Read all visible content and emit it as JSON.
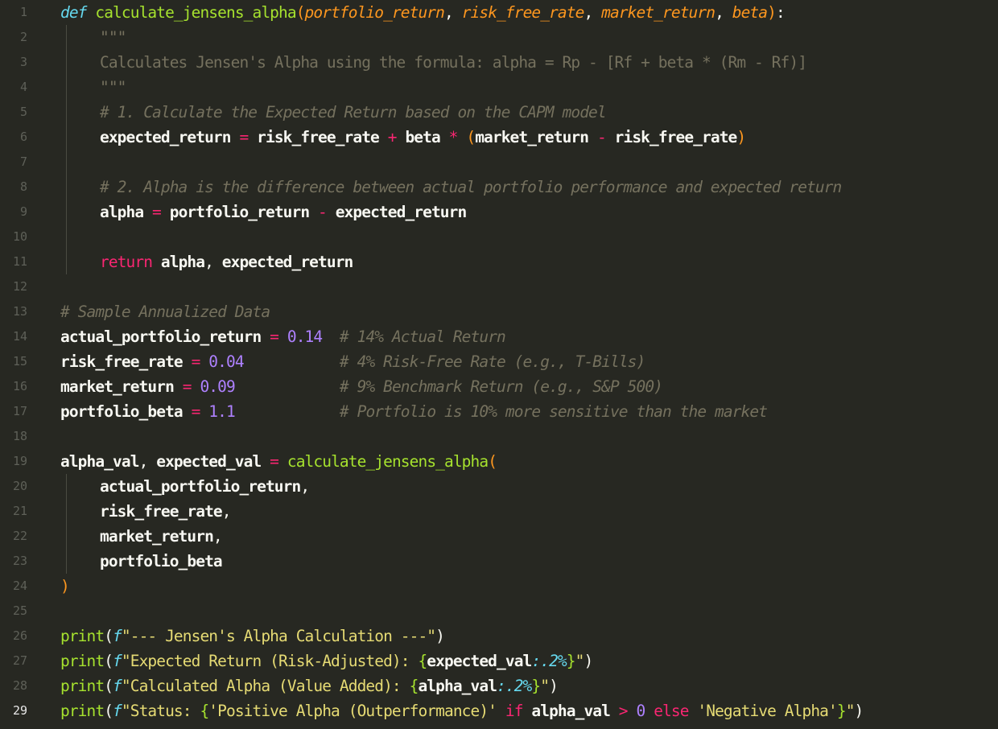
{
  "editor": {
    "language": "python",
    "current_line": 29,
    "lines": [
      {
        "n": "1",
        "indent": 0,
        "tokens": [
          [
            "kw",
            "def"
          ],
          [
            "pc",
            " "
          ],
          [
            "fn",
            "calculate_jensens_alpha"
          ],
          [
            "pn",
            "("
          ],
          [
            "par",
            "portfolio_return"
          ],
          [
            "pc",
            ", "
          ],
          [
            "par",
            "risk_free_rate"
          ],
          [
            "pc",
            ", "
          ],
          [
            "par",
            "market_return"
          ],
          [
            "pc",
            ", "
          ],
          [
            "par",
            "beta"
          ],
          [
            "pn",
            ")"
          ],
          [
            "pc",
            ":"
          ]
        ]
      },
      {
        "n": "2",
        "indent": 1,
        "tokens": [
          [
            "doc",
            "\"\"\""
          ]
        ]
      },
      {
        "n": "3",
        "indent": 1,
        "tokens": [
          [
            "doc",
            "Calculates Jensen's Alpha using the formula: alpha = Rp - [Rf + beta * (Rm - Rf)]"
          ]
        ]
      },
      {
        "n": "4",
        "indent": 1,
        "tokens": [
          [
            "doc",
            "\"\"\""
          ]
        ]
      },
      {
        "n": "5",
        "indent": 1,
        "tokens": [
          [
            "cm",
            "# 1. Calculate the Expected Return based on the CAPM model"
          ]
        ]
      },
      {
        "n": "6",
        "indent": 1,
        "tokens": [
          [
            "id",
            "expected_return"
          ],
          [
            "op",
            " = "
          ],
          [
            "id",
            "risk_free_rate"
          ],
          [
            "op",
            " + "
          ],
          [
            "id",
            "beta"
          ],
          [
            "op",
            " * "
          ],
          [
            "pn",
            "("
          ],
          [
            "id",
            "market_return"
          ],
          [
            "op",
            " - "
          ],
          [
            "id",
            "risk_free_rate"
          ],
          [
            "pn",
            ")"
          ]
        ]
      },
      {
        "n": "7",
        "indent": 0,
        "tokens": []
      },
      {
        "n": "8",
        "indent": 1,
        "tokens": [
          [
            "cm",
            "# 2. Alpha is the difference between actual portfolio performance and expected return"
          ]
        ]
      },
      {
        "n": "9",
        "indent": 1,
        "tokens": [
          [
            "id",
            "alpha"
          ],
          [
            "op",
            " = "
          ],
          [
            "id",
            "portfolio_return"
          ],
          [
            "op",
            " - "
          ],
          [
            "id",
            "expected_return"
          ]
        ]
      },
      {
        "n": "10",
        "indent": 0,
        "tokens": []
      },
      {
        "n": "11",
        "indent": 1,
        "tokens": [
          [
            "kr",
            "return"
          ],
          [
            "pc",
            " "
          ],
          [
            "id",
            "alpha"
          ],
          [
            "pc",
            ", "
          ],
          [
            "id",
            "expected_return"
          ]
        ]
      },
      {
        "n": "12",
        "indent": 0,
        "tokens": []
      },
      {
        "n": "13",
        "indent": 0,
        "tokens": [
          [
            "cm",
            "# Sample Annualized Data"
          ]
        ]
      },
      {
        "n": "14",
        "indent": 0,
        "tokens": [
          [
            "id",
            "actual_portfolio_return"
          ],
          [
            "op",
            " = "
          ],
          [
            "num",
            "0.14"
          ],
          [
            "pc",
            "  "
          ],
          [
            "cm",
            "# 14% Actual Return"
          ]
        ]
      },
      {
        "n": "15",
        "indent": 0,
        "tokens": [
          [
            "id",
            "risk_free_rate"
          ],
          [
            "op",
            " = "
          ],
          [
            "num",
            "0.04"
          ],
          [
            "pc",
            "           "
          ],
          [
            "cm",
            "# 4% Risk-Free Rate (e.g., T-Bills)"
          ]
        ]
      },
      {
        "n": "16",
        "indent": 0,
        "tokens": [
          [
            "id",
            "market_return"
          ],
          [
            "op",
            " = "
          ],
          [
            "num",
            "0.09"
          ],
          [
            "pc",
            "            "
          ],
          [
            "cm",
            "# 9% Benchmark Return (e.g., S&P 500)"
          ]
        ]
      },
      {
        "n": "17",
        "indent": 0,
        "tokens": [
          [
            "id",
            "portfolio_beta"
          ],
          [
            "op",
            " = "
          ],
          [
            "num",
            "1.1"
          ],
          [
            "pc",
            "            "
          ],
          [
            "cm",
            "# Portfolio is 10% more sensitive than the market"
          ]
        ]
      },
      {
        "n": "18",
        "indent": 0,
        "tokens": []
      },
      {
        "n": "19",
        "indent": 0,
        "tokens": [
          [
            "id",
            "alpha_val"
          ],
          [
            "pc",
            ", "
          ],
          [
            "id",
            "expected_val"
          ],
          [
            "op",
            " = "
          ],
          [
            "fn",
            "calculate_jensens_alpha"
          ],
          [
            "pn",
            "("
          ]
        ]
      },
      {
        "n": "20",
        "indent": 1,
        "tokens": [
          [
            "id",
            "actual_portfolio_return"
          ],
          [
            "pc",
            ","
          ]
        ]
      },
      {
        "n": "21",
        "indent": 1,
        "tokens": [
          [
            "id",
            "risk_free_rate"
          ],
          [
            "pc",
            ","
          ]
        ]
      },
      {
        "n": "22",
        "indent": 1,
        "tokens": [
          [
            "id",
            "market_return"
          ],
          [
            "pc",
            ","
          ]
        ]
      },
      {
        "n": "23",
        "indent": 1,
        "tokens": [
          [
            "id",
            "portfolio_beta"
          ]
        ]
      },
      {
        "n": "24",
        "indent": 0,
        "tokens": [
          [
            "pn",
            ")"
          ]
        ]
      },
      {
        "n": "25",
        "indent": 0,
        "tokens": []
      },
      {
        "n": "26",
        "indent": 0,
        "tokens": [
          [
            "fn",
            "print"
          ],
          [
            "pc",
            "("
          ],
          [
            "fx",
            "f"
          ],
          [
            "str",
            "\"--- Jensen's Alpha Calculation ---\""
          ],
          [
            "pc",
            ")"
          ]
        ]
      },
      {
        "n": "27",
        "indent": 0,
        "tokens": [
          [
            "fn",
            "print"
          ],
          [
            "pc",
            "("
          ],
          [
            "fx",
            "f"
          ],
          [
            "str",
            "\"Expected Return (Risk-Adjusted): "
          ],
          [
            "fk",
            "{"
          ],
          [
            "id",
            "expected_val"
          ],
          [
            "fx",
            ":.2%"
          ],
          [
            "fk",
            "}"
          ],
          [
            "str",
            "\""
          ],
          [
            "pc",
            ")"
          ]
        ]
      },
      {
        "n": "28",
        "indent": 0,
        "tokens": [
          [
            "fn",
            "print"
          ],
          [
            "pc",
            "("
          ],
          [
            "fx",
            "f"
          ],
          [
            "str",
            "\"Calculated Alpha (Value Added): "
          ],
          [
            "fk",
            "{"
          ],
          [
            "id",
            "alpha_val"
          ],
          [
            "fx",
            ":.2%"
          ],
          [
            "fk",
            "}"
          ],
          [
            "str",
            "\""
          ],
          [
            "pc",
            ")"
          ]
        ]
      },
      {
        "n": "29",
        "indent": 0,
        "tokens": [
          [
            "fn",
            "print"
          ],
          [
            "pc",
            "("
          ],
          [
            "fx",
            "f"
          ],
          [
            "str",
            "\"Status: "
          ],
          [
            "fk",
            "{"
          ],
          [
            "str",
            "'Positive Alpha (Outperformance)'"
          ],
          [
            "pc",
            " "
          ],
          [
            "kr",
            "if"
          ],
          [
            "pc",
            " "
          ],
          [
            "id",
            "alpha_val"
          ],
          [
            "op",
            " > "
          ],
          [
            "num",
            "0"
          ],
          [
            "pc",
            " "
          ],
          [
            "kr",
            "else"
          ],
          [
            "pc",
            " "
          ],
          [
            "str",
            "'Negative Alpha'"
          ],
          [
            "fk",
            "}"
          ],
          [
            "str",
            "\""
          ],
          [
            "pc",
            ")"
          ]
        ]
      }
    ],
    "indent_guides": [
      {
        "from_line": 2,
        "to_line": 11
      },
      {
        "from_line": 20,
        "to_line": 23
      }
    ]
  }
}
